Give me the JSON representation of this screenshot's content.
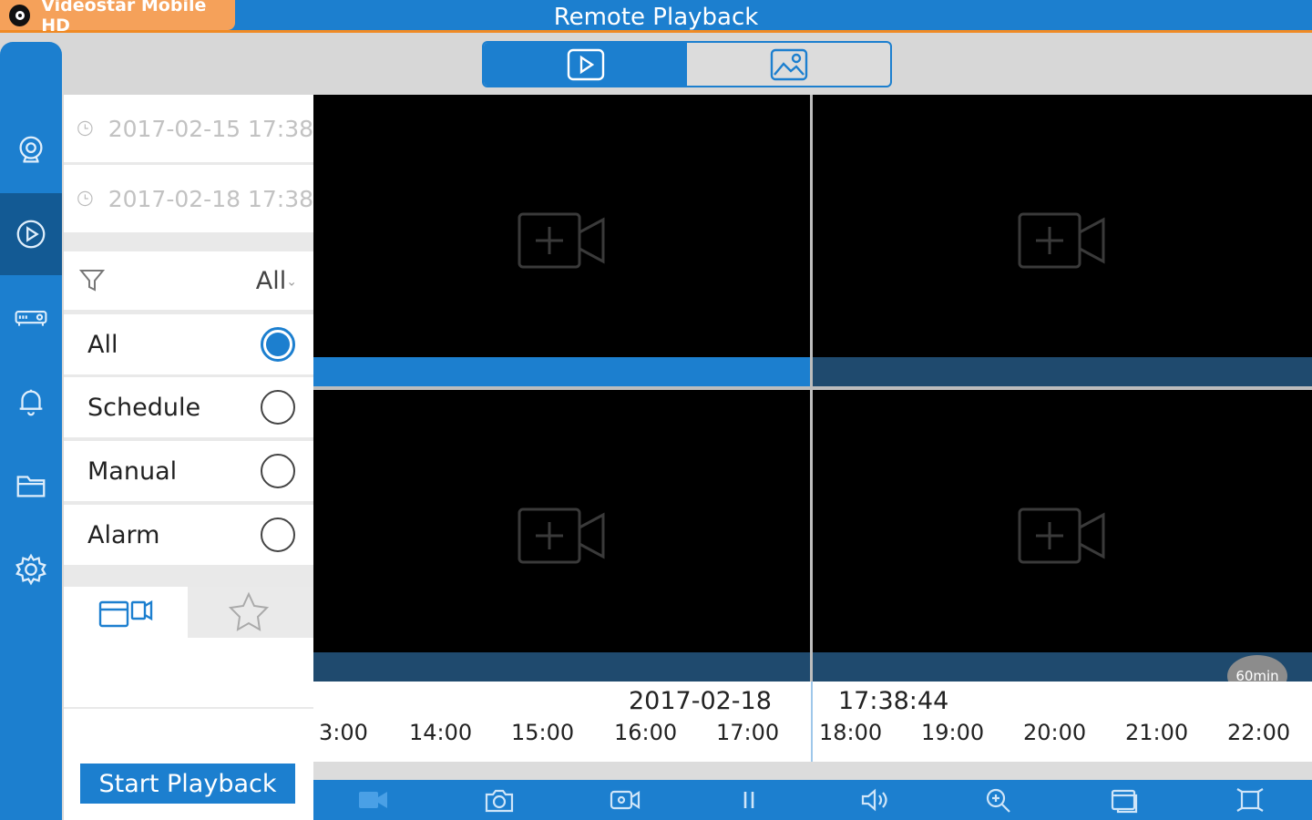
{
  "app": {
    "name": "Videostar Mobile HD",
    "title": "Remote Playback"
  },
  "colors": {
    "accent": "#1c7fcf",
    "accent_dark": "#135a94",
    "orange": "#f08a24"
  },
  "sidebar": {
    "items": [
      {
        "name": "live-view",
        "icon": "webcam-icon",
        "active": false
      },
      {
        "name": "playback",
        "icon": "play-circle-icon",
        "active": true
      },
      {
        "name": "devices",
        "icon": "dvr-device-icon",
        "active": false
      },
      {
        "name": "alarms",
        "icon": "bell-icon",
        "active": false
      },
      {
        "name": "files",
        "icon": "folder-icon",
        "active": false
      },
      {
        "name": "settings",
        "icon": "gear-icon",
        "active": false
      }
    ]
  },
  "mode_toggle": {
    "video": "video-play-icon",
    "picture": "picture-icon",
    "active": "video"
  },
  "search": {
    "start_time": "2017-02-15 17:38",
    "end_time": "2017-02-18 17:38",
    "filter_value": "All",
    "options": [
      {
        "label": "All",
        "selected": true
      },
      {
        "label": "Schedule",
        "selected": false
      },
      {
        "label": "Manual",
        "selected": false
      },
      {
        "label": "Alarm",
        "selected": false
      }
    ],
    "start_button": "Start Playback"
  },
  "timeline": {
    "date": "2017-02-18",
    "time": "17:38:44",
    "interval": "60min",
    "ticks": [
      "3:00",
      "14:00",
      "15:00",
      "16:00",
      "17:00",
      "18:00",
      "19:00",
      "20:00",
      "21:00",
      "22:00"
    ]
  },
  "toolbar": {
    "items": [
      "record-camera-icon",
      "snapshot-icon",
      "record-icon",
      "pause-icon",
      "volume-icon",
      "zoom-icon",
      "window-icon",
      "fullscreen-icon"
    ]
  }
}
